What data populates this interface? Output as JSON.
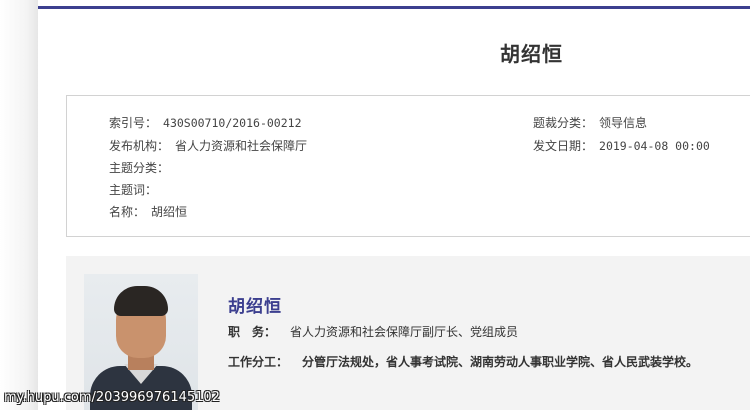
{
  "page": {
    "title": "胡绍恒"
  },
  "meta": {
    "index_label": "索引号：",
    "index_value": "430S00710/2016-00212",
    "genre_label": "题裁分类：",
    "genre_value": "领导信息",
    "publisher_label": "发布机构：",
    "publisher_value": "省人力资源和社会保障厅",
    "date_label": "发文日期：",
    "date_value": "2019-04-08 00:00",
    "topic_label": "主题分类：",
    "topic_value": "",
    "keywords_label": "主题词：",
    "keywords_value": "",
    "name_label": "名称：",
    "name_value": "胡绍恒"
  },
  "profile": {
    "name": "胡绍恒",
    "duty_label": "职　务：",
    "duty_value": "省人力资源和社会保障厅副厅长、党组成员",
    "work_label": "工作分工：",
    "work_value": "分管厅法规处，省人事考试院、湖南劳动人事职业学院、省人民武装学校。"
  },
  "watermark": {
    "text": "my.hupu.com/203996976145102"
  },
  "colors": {
    "accent": "#3c3f8f",
    "profile_bg": "#f3f3f3",
    "border": "#d2d2d2"
  }
}
